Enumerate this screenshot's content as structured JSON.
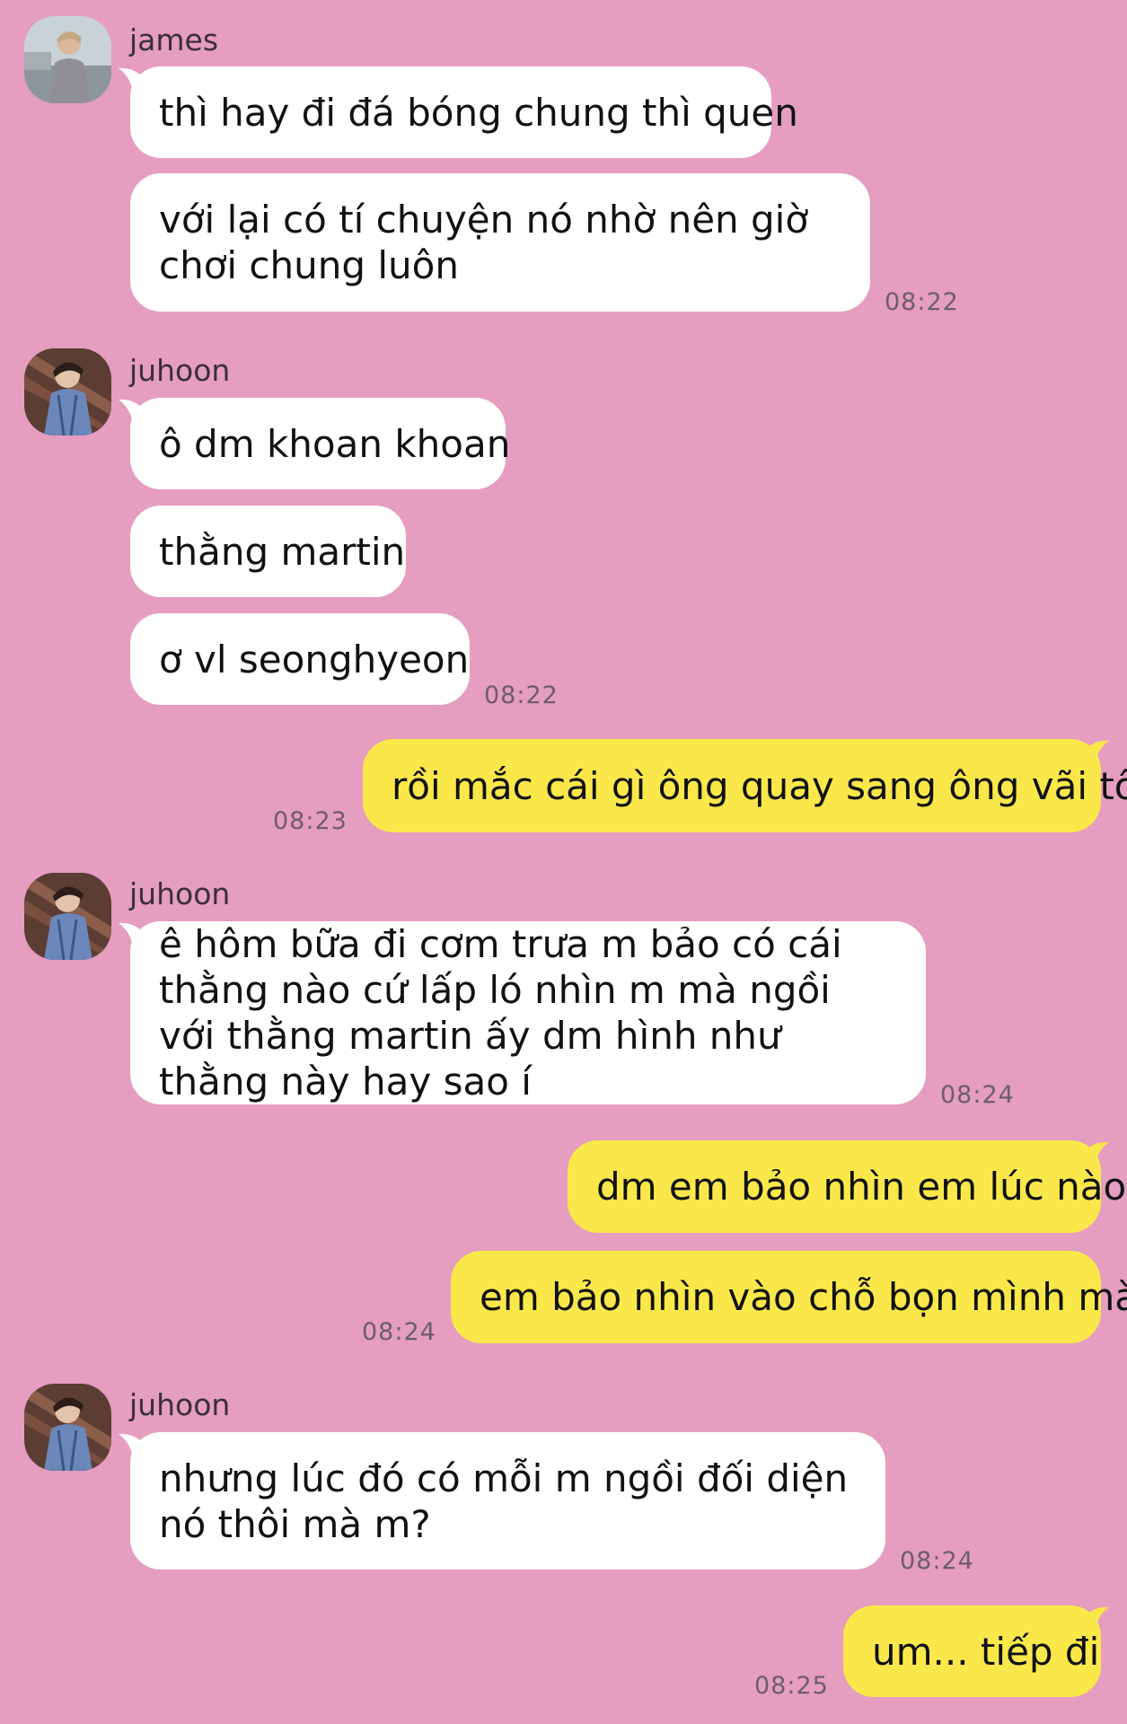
{
  "messages": {
    "m1": {
      "sender": "james",
      "text": "thì hay đi đá bóng chung thì quen"
    },
    "m2": {
      "text": "với lại có tí chuyện nó nhờ nên giờ chơi chung luôn",
      "time": "08:22"
    },
    "m3": {
      "sender": "juhoon",
      "text": "ô dm khoan khoan"
    },
    "m4": {
      "text": "thằng martin"
    },
    "m5": {
      "text": "ơ vl seonghyeon",
      "time": "08:22"
    },
    "m6": {
      "text": "rồi mắc cái gì ông quay sang ông vãi tôi",
      "time": "08:23"
    },
    "m7": {
      "sender": "juhoon",
      "text": "ê hôm bữa đi cơm trưa m bảo có cái thằng nào cứ lấp ló nhìn m mà ngồi với thằng martin ấy dm hình như thằng này hay sao í",
      "time": "08:24"
    },
    "m8": {
      "text": "dm em bảo nhìn em lúc nào"
    },
    "m9": {
      "text": "em bảo nhìn vào chỗ bọn mình mà",
      "time": "08:24"
    },
    "m10": {
      "sender": "juhoon",
      "text": "nhưng lúc đó có mỗi m ngồi đối diện nó thôi mà m?",
      "time": "08:24"
    },
    "m11": {
      "text": "um... tiếp đi",
      "time": "08:25"
    }
  },
  "avatars": {
    "james": "avatar-photo-james",
    "juhoon": "avatar-photo-juhoon"
  },
  "colors": {
    "background": "#E59DC0",
    "incoming_bubble": "#FFFFFF",
    "outgoing_bubble": "#FAE84A"
  }
}
